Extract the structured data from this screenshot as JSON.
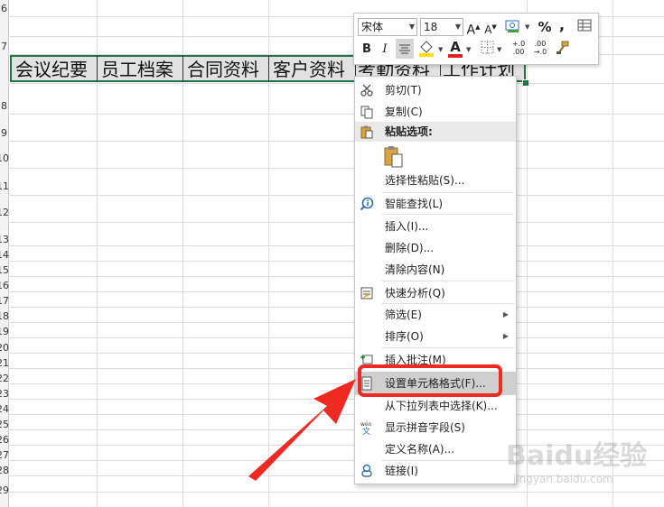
{
  "row_numbers": [
    "6",
    "7",
    "8",
    "9",
    "10",
    "11",
    "12",
    "13",
    "14",
    "15",
    "16",
    "17",
    "18",
    "19",
    "20",
    "21",
    "22",
    "23",
    "24",
    "25",
    "26",
    "27",
    "28",
    "29"
  ],
  "selected_cells": [
    "会议纪要",
    "员工档案",
    "合同资料",
    "客户资料",
    "考勤资料",
    "工作计划"
  ],
  "mini_toolbar": {
    "font_name": "宋体",
    "font_size": "18",
    "grow_font": "A",
    "shrink_font": "A",
    "percent": "%",
    "comma": ",",
    "bold": "B",
    "italic": "I",
    "font_color_letter": "A",
    "inc_decimal": "+.0 .00",
    "dec_decimal": ".00 →.0",
    "font_color_hex": "#e02020",
    "fill_color_hex": "#ffe000"
  },
  "context_menu": {
    "cut": "剪切(T)",
    "copy": "复制(C)",
    "paste_options": "粘贴选项:",
    "paste_special": "选择性粘贴(S)...",
    "smart_lookup": "智能查找(L)",
    "insert": "插入(I)...",
    "delete": "删除(D)...",
    "clear_contents": "清除内容(N)",
    "quick_analysis": "快速分析(Q)",
    "filter": "筛选(E)",
    "sort": "排序(O)",
    "insert_comment": "插入批注(M)",
    "format_cells": "设置单元格格式(F)...",
    "pick_from_list": "从下拉列表中选择(K)...",
    "phonetic": "显示拼音字段(S)",
    "define_name": "定义名称(A)...",
    "link": "链接(I)"
  },
  "icons": {
    "cut": "scissors-icon",
    "copy": "copy-icon",
    "paste": "clipboard-icon",
    "smart_lookup": "search-info-icon",
    "quick_analysis": "quick-analysis-icon",
    "insert_comment": "comment-icon",
    "format_cells": "format-cells-icon",
    "phonetic": "phonetic-icon",
    "link": "link-icon"
  },
  "colors": {
    "selection_border": "#217346",
    "annotation_red": "#ee2a22",
    "highlight": "#cfcfcf"
  }
}
